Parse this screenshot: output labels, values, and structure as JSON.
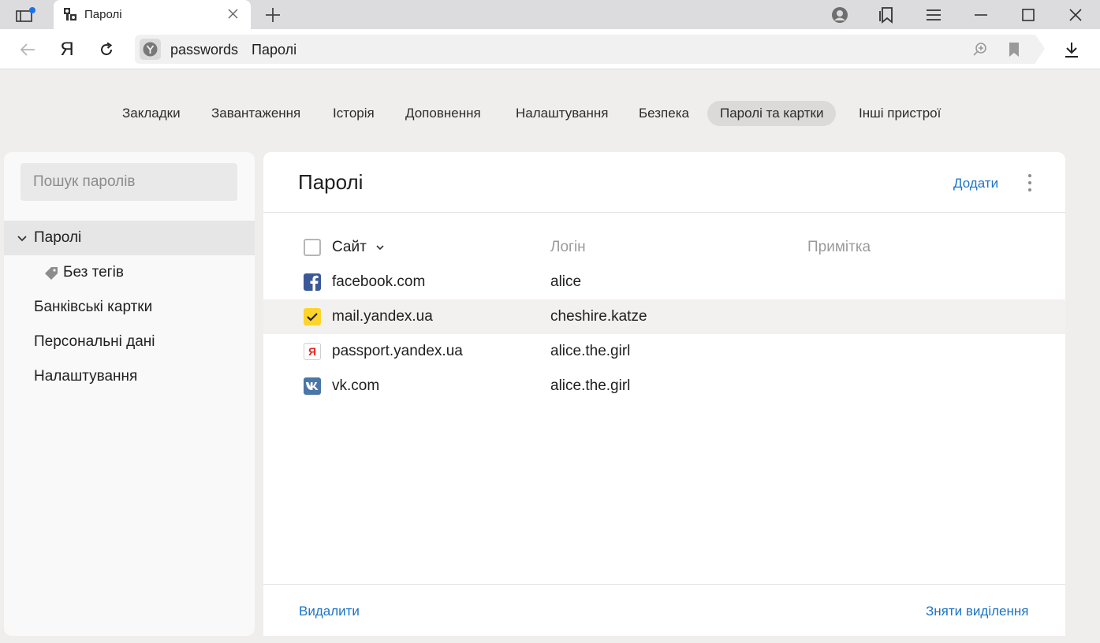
{
  "browser": {
    "tab_title": "Паролі",
    "address_host": "passwords",
    "address_title": "Паролі",
    "yandex_letter": "Я"
  },
  "settings_tabs": [
    {
      "label": "Закладки"
    },
    {
      "label": "Завантаження"
    },
    {
      "label": "Історія"
    },
    {
      "label": "Доповнення"
    },
    {
      "label": "Налаштування"
    },
    {
      "label": "Безпека"
    },
    {
      "label": "Паролі та картки",
      "active": true
    },
    {
      "label": "Інші пристрої"
    }
  ],
  "sidebar": {
    "search_placeholder": "Пошук паролів",
    "items": [
      {
        "label": "Паролі",
        "active": true,
        "expanded": true
      },
      {
        "label": "Без тегів",
        "icon": "tag-icon"
      },
      {
        "label": "Банківські картки"
      },
      {
        "label": "Персональні дані"
      },
      {
        "label": "Налаштування"
      }
    ]
  },
  "main": {
    "title": "Паролі",
    "add_label": "Додати",
    "columns": {
      "site": "Сайт",
      "login": "Логін",
      "note": "Примітка"
    },
    "rows": [
      {
        "site": "facebook.com",
        "login": "alice",
        "icon": "facebook-icon",
        "icon_color": "#3b5998",
        "selected": false
      },
      {
        "site": "mail.yandex.ua",
        "login": "cheshire.katze",
        "icon": "checkbox-checked-icon",
        "icon_color": "#fed42b",
        "selected": true
      },
      {
        "site": "passport.yandex.ua",
        "login": "alice.the.girl",
        "icon": "yandex-icon",
        "icon_color": "#e52620",
        "selected": false
      },
      {
        "site": "vk.com",
        "login": "alice.the.girl",
        "icon": "vk-icon",
        "icon_color": "#4a76a8",
        "selected": false
      }
    ],
    "delete_label": "Видалити",
    "deselect_label": "Зняти виділення"
  },
  "colors": {
    "accent_link": "#1a73c6",
    "check_yellow": "#fed42b",
    "page_bg": "#f0eeec"
  }
}
